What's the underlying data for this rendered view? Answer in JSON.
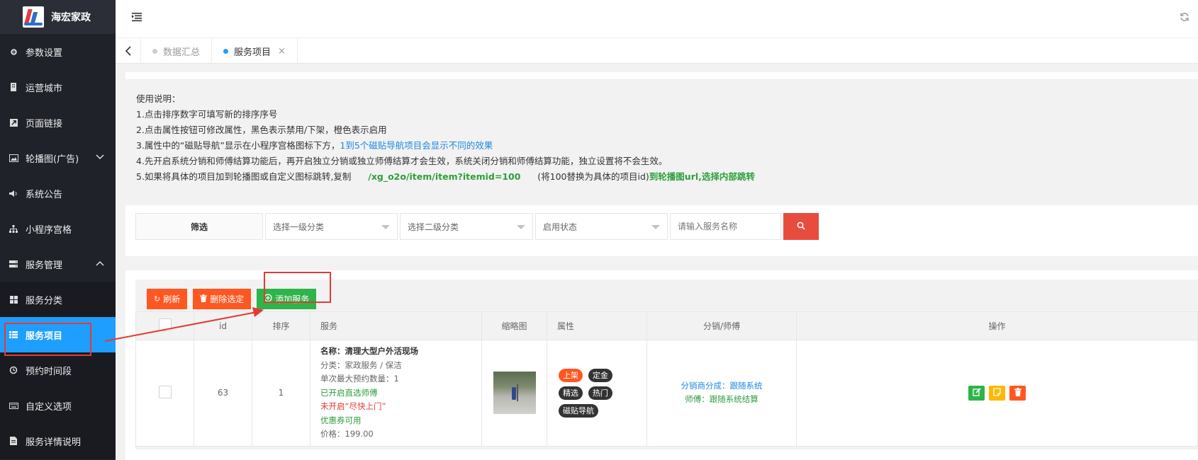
{
  "app": {
    "logo_text": "海宏家政"
  },
  "sidebar": {
    "items": [
      {
        "label": "参数设置",
        "icon": "gear-icon"
      },
      {
        "label": "运营城市",
        "icon": "building-icon"
      },
      {
        "label": "页面链接",
        "icon": "link-icon"
      },
      {
        "label": "轮播图(广告)",
        "icon": "image-icon"
      },
      {
        "label": "系统公告",
        "icon": "speaker-icon"
      },
      {
        "label": "小程序宫格",
        "icon": "sitemap-icon"
      },
      {
        "label": "服务管理",
        "icon": "server-icon"
      },
      {
        "label": "服务分类",
        "icon": "grid-icon"
      },
      {
        "label": "服务项目",
        "icon": "list-icon"
      },
      {
        "label": "预约时间段",
        "icon": "history-icon"
      },
      {
        "label": "自定义选项",
        "icon": "keyboard-icon"
      },
      {
        "label": "服务详情说明",
        "icon": "file-icon"
      }
    ]
  },
  "tabs": [
    {
      "label": "数据汇总"
    },
    {
      "label": "服务项目"
    }
  ],
  "notice": {
    "title": "使用说明：",
    "line1": "1.点击排序数字可填写新的排序序号",
    "line2": "2.点击属性按钮可修改属性，黑色表示禁用/下架，橙色表示启用",
    "line3_a": "3.属性中的“磁贴导航”显示在小程序宫格图标下方，",
    "line3_b": "1到5个磁贴导航项目会显示不同的效果",
    "line4": "4.先开启系统分销和师傅结算功能后，再开启独立分销或独立师傅结算才会生效，系统关闭分销和师傅结算功能，独立设置将不会生效。",
    "line5_a": "5.如果将具体的项目加到轮播图或自定义图标跳转,复制",
    "line5_b": "/xg_o2o/item/item?itemid=100",
    "line5_c": "(将100替换为具体的项目id)",
    "line5_d": "到轮播图url,选择内部跳转"
  },
  "filter": {
    "label": "筛选",
    "select1": "选择一级分类",
    "select2": "选择二级分类",
    "select3": "启用状态",
    "search_placeholder": "请输入服务名称"
  },
  "toolbar": {
    "refresh": "刷新",
    "delete_selected": "删除选定",
    "add_service": "添加服务"
  },
  "table": {
    "headers": [
      "id",
      "排序",
      "服务",
      "缩略图",
      "属性",
      "分销/师傅",
      "操作"
    ],
    "rows": [
      {
        "id": "63",
        "sort": "1",
        "name": "名称：清理大型户外活现场",
        "category": "分类：家政服务 / 保洁",
        "max_qty": "单次最大预约数量：1",
        "direct_master": "已开启直选师傅",
        "fast_door": "未开启“尽快上门”",
        "coupon": "优惠券可用",
        "price": "价格：199.00",
        "tags": [
          {
            "label": "上架",
            "on": true
          },
          {
            "label": "定金",
            "on": false
          },
          {
            "label": "精选",
            "on": false
          },
          {
            "label": "热门",
            "on": false
          },
          {
            "label": "磁贴导航",
            "on": false
          }
        ],
        "distribution": "分销商分成：跟随系统",
        "master": "师傅：跟随系统结算"
      }
    ]
  },
  "colors": {
    "sidebar_bg": "#20222a",
    "active_blue": "#1e9fff",
    "orange": "#ff5722",
    "green": "#2eb44a",
    "yellow": "#ffb800",
    "search_red": "#e84c3d"
  }
}
